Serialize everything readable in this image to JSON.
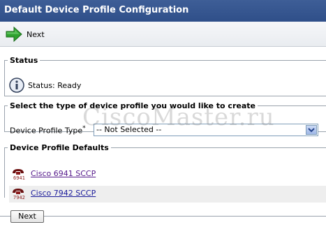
{
  "window": {
    "title": "Default Device Profile Configuration"
  },
  "toolbar": {
    "next_label": "Next"
  },
  "status": {
    "legend": "Status",
    "text": "Status: Ready"
  },
  "type_section": {
    "legend": "Select the type of device profile you would like to create",
    "label": "Device Profile Type",
    "required_mark": "*",
    "selected": "-- Not Selected --"
  },
  "defaults": {
    "legend": "Device Profile Defaults",
    "items": [
      {
        "label": "Cisco 6941 SCCP",
        "model": "6941"
      },
      {
        "label": "Cisco 7942 SCCP",
        "model": "7942"
      }
    ]
  },
  "footer": {
    "next_label": "Next"
  },
  "watermark": "CiscoMaster.ru",
  "colors": {
    "title_bar": "#2f4f89",
    "link_visited": "#551a8b",
    "link": "#1a1a9a",
    "row_alt": "#eeeeee"
  }
}
